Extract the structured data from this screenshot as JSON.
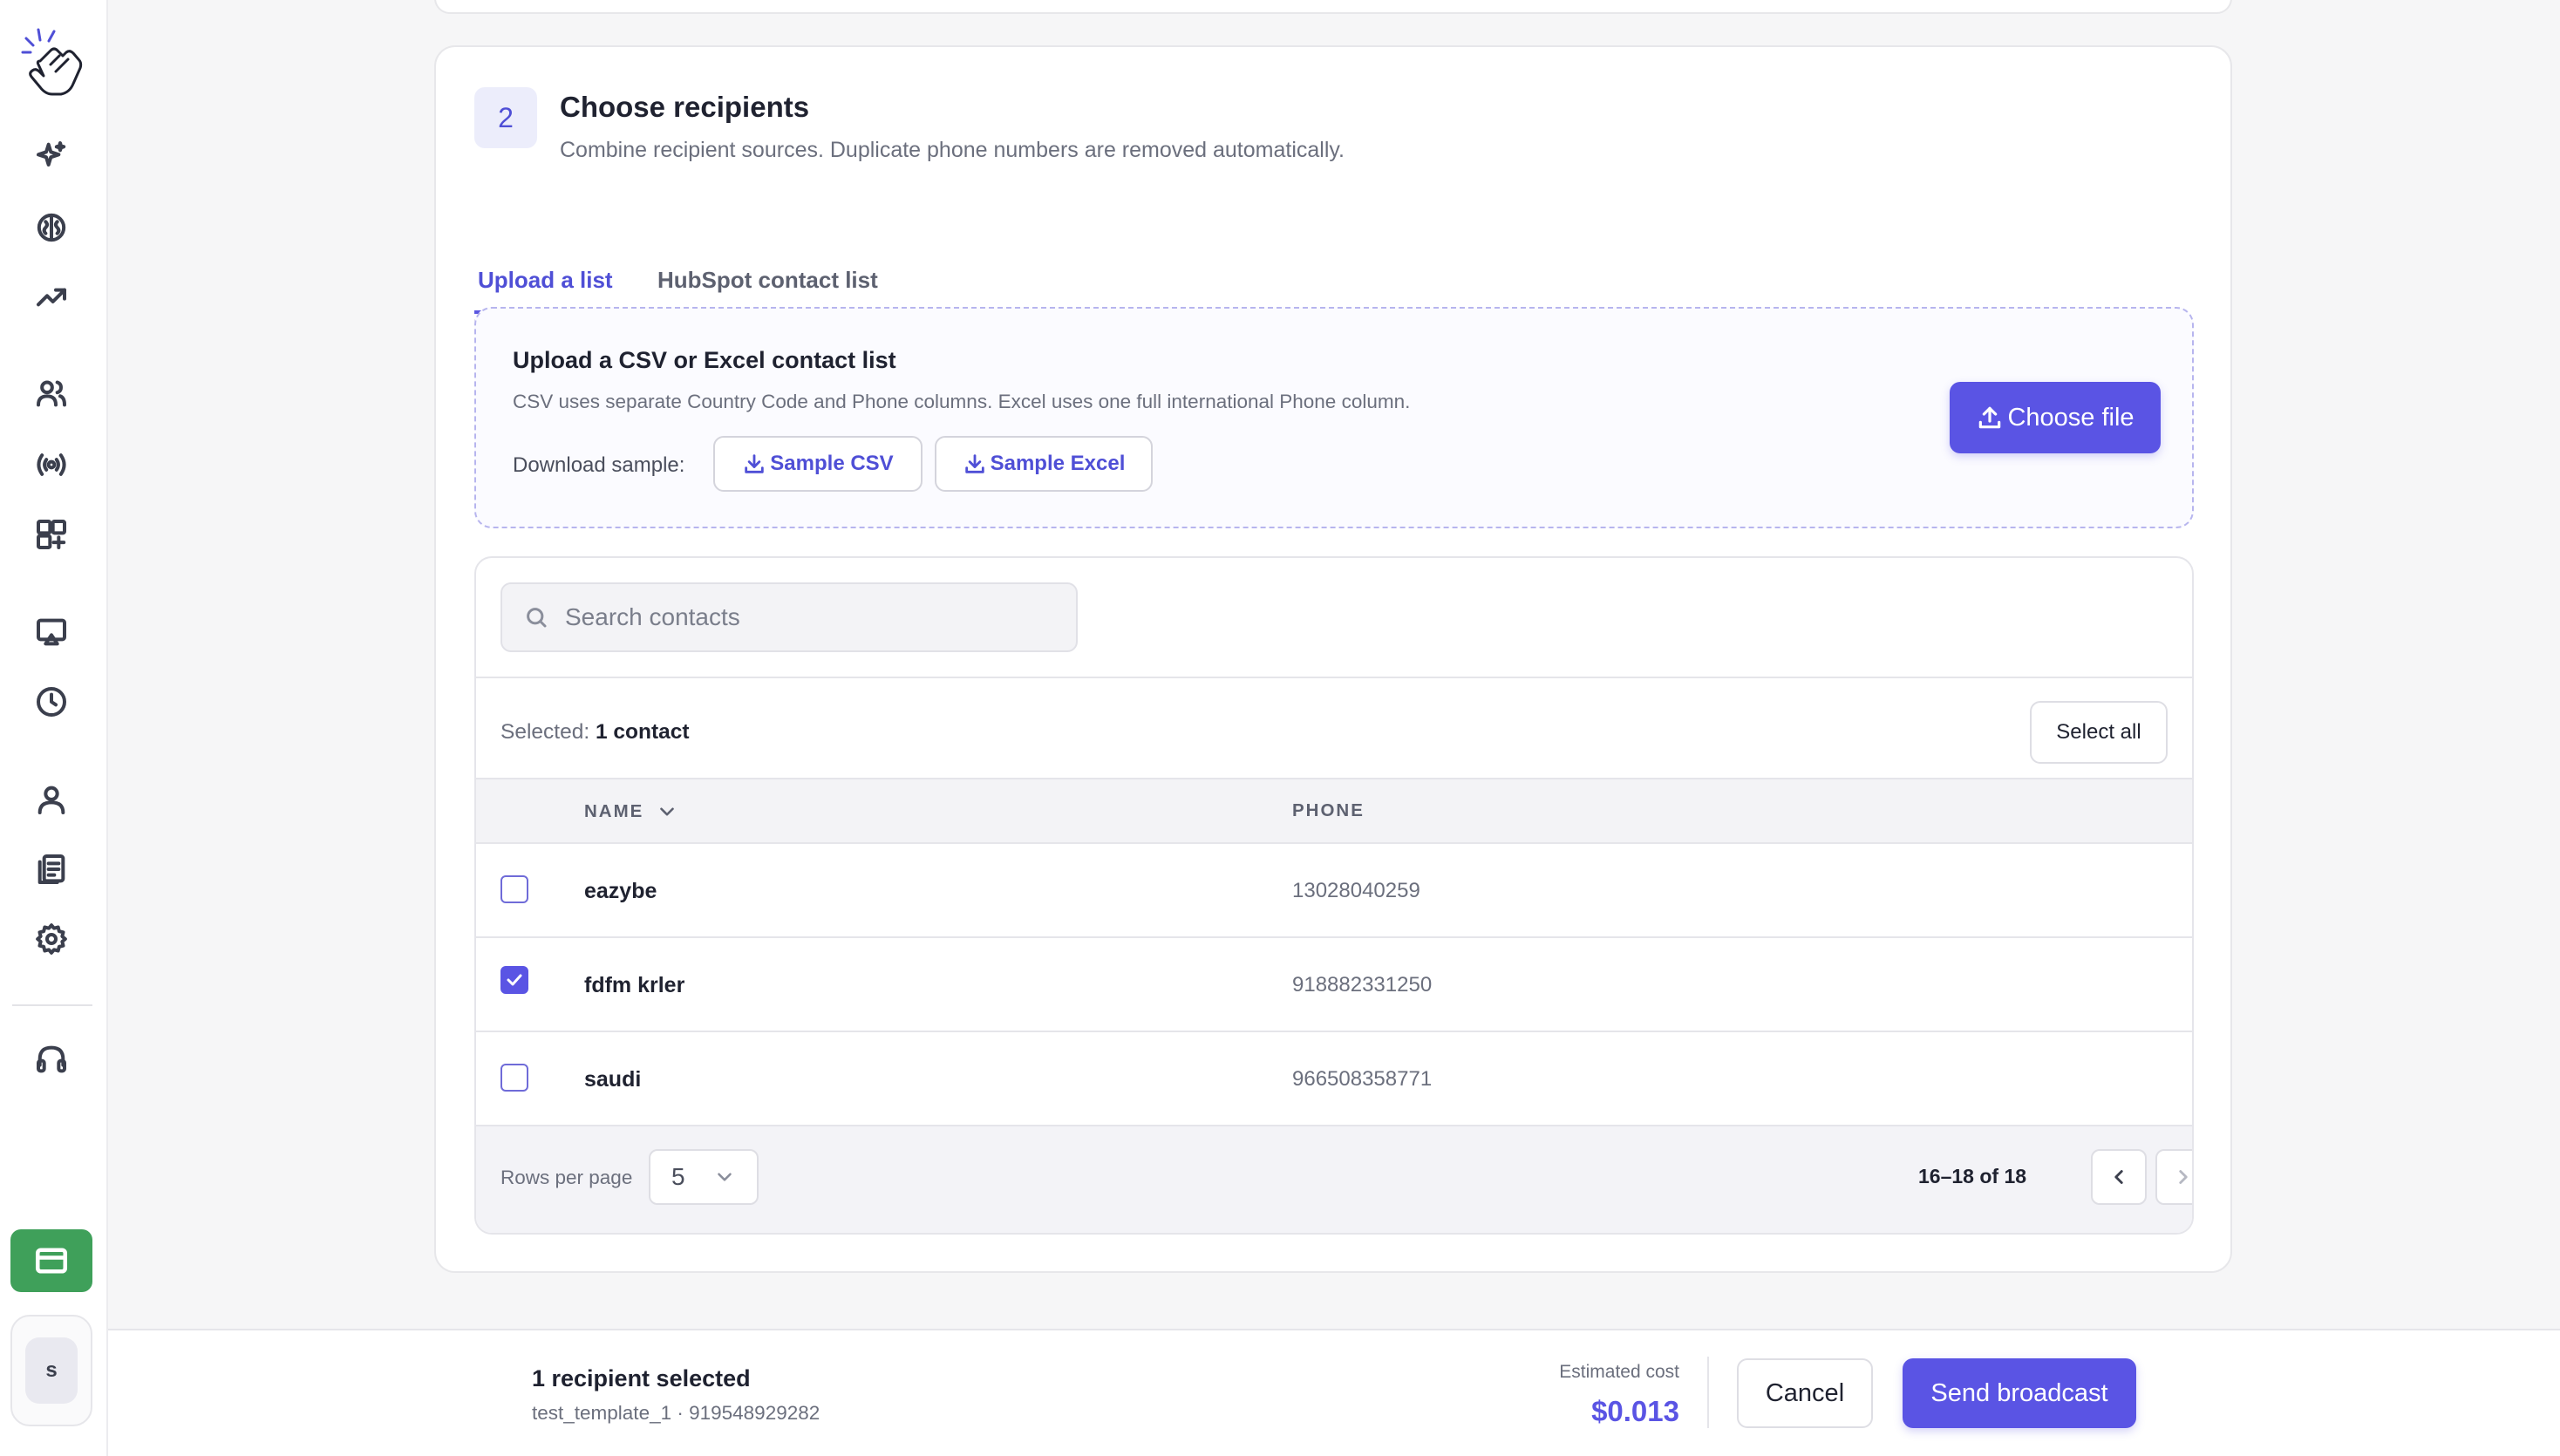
{
  "sidebar": {
    "logo_icon": "tap-hand-icon",
    "items": [
      {
        "icon": "sparkles-icon"
      },
      {
        "icon": "brain-icon"
      },
      {
        "icon": "trending-up-icon"
      },
      {
        "icon": "users-icon"
      },
      {
        "icon": "broadcast-icon"
      },
      {
        "icon": "grid-plus-icon"
      },
      {
        "icon": "monitor-icon"
      },
      {
        "icon": "clock-icon"
      },
      {
        "icon": "user-icon"
      },
      {
        "icon": "documents-icon"
      },
      {
        "icon": "settings-icon"
      },
      {
        "icon": "headset-icon"
      }
    ],
    "billing_icon": "credit-card-icon",
    "avatar_initial": "s",
    "billing_color": "#3fa05a"
  },
  "step": {
    "number": "2",
    "title": "Choose recipients",
    "subtitle": "Combine recipient sources. Duplicate phone numbers are removed automatically."
  },
  "tabs": [
    {
      "label": "Upload a list",
      "active": true
    },
    {
      "label": "HubSpot contact list",
      "active": false
    }
  ],
  "upload": {
    "title": "Upload a CSV or Excel contact list",
    "description": "CSV uses separate Country Code and Phone columns. Excel uses one full international Phone column.",
    "download_label": "Download sample:",
    "sample_csv": "Sample CSV",
    "sample_excel": "Sample Excel",
    "choose_file": "Choose file"
  },
  "contacts": {
    "search_placeholder": "Search contacts",
    "selected_label": "Selected:",
    "selected_count": "1 contact",
    "select_all": "Select all",
    "columns": {
      "name": "NAME",
      "phone": "PHONE"
    },
    "rows": [
      {
        "name": "eazybe",
        "phone": "13028040259",
        "checked": false
      },
      {
        "name": "fdfm krler",
        "phone": "918882331250",
        "checked": true
      },
      {
        "name": "saudi",
        "phone": "966508358771",
        "checked": false
      }
    ],
    "rows_per_page_label": "Rows per page",
    "rows_per_page": "5",
    "range": "16–18 of 18"
  },
  "footer": {
    "title": "1 recipient selected",
    "subtitle": "test_template_1 · 919548929282",
    "cost_label": "Estimated cost",
    "cost_value": "$0.013",
    "cancel": "Cancel",
    "send": "Send broadcast"
  },
  "colors": {
    "accent": "#5a54e4",
    "accent_text": "#4f4fd6"
  }
}
